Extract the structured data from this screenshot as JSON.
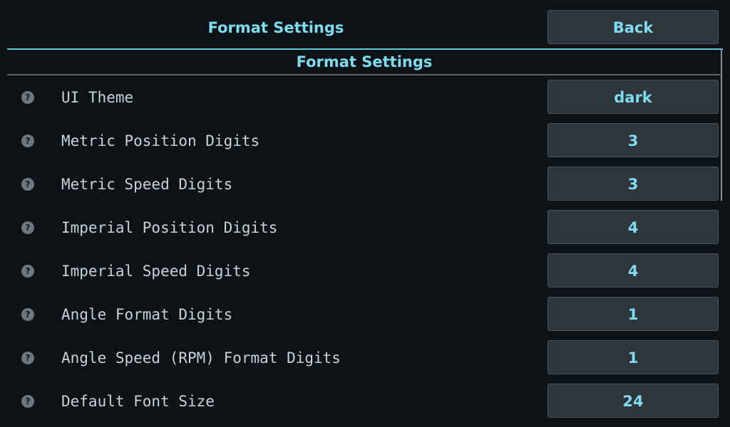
{
  "header": {
    "title": "Format Settings",
    "back_label": "Back"
  },
  "section": {
    "title": "Format Settings"
  },
  "settings": [
    {
      "label": "UI Theme",
      "value": "dark"
    },
    {
      "label": "Metric Position Digits",
      "value": "3"
    },
    {
      "label": "Metric Speed Digits",
      "value": "3"
    },
    {
      "label": "Imperial Position Digits",
      "value": "4"
    },
    {
      "label": "Imperial Speed Digits",
      "value": "4"
    },
    {
      "label": "Angle Format Digits",
      "value": "1"
    },
    {
      "label": "Angle Speed (RPM) Format Digits",
      "value": "1"
    },
    {
      "label": "Default Font Size",
      "value": "24"
    }
  ],
  "icons": {
    "help": "?"
  },
  "colors": {
    "background": "#0d1216",
    "accent": "#7fdcef",
    "button_bg": "#2e353b",
    "label_text": "#c9d2d8"
  }
}
